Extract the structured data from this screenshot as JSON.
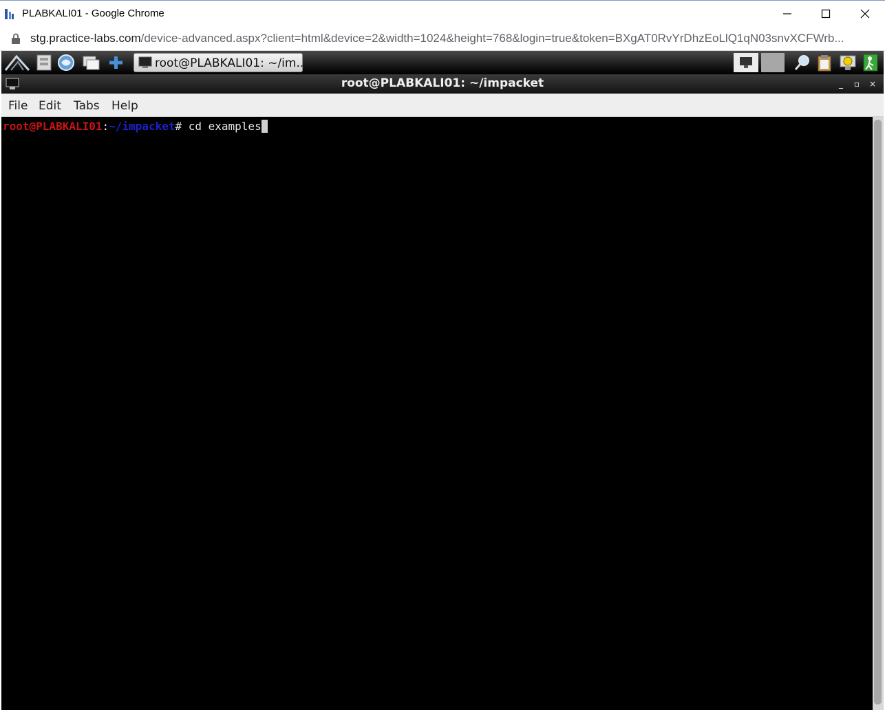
{
  "browser": {
    "window_title": "PLABKALI01 - Google Chrome",
    "url_host": "stg.practice-labs.com",
    "url_path": "/device-advanced.aspx?client=html&device=2&width=1024&height=768&login=true&token=BXgAT0RvYrDhzEoLlQ1qN03snvXCFWrb...",
    "controls": [
      "minimize-icon",
      "maximize-icon",
      "close-icon"
    ]
  },
  "panel": {
    "launchers": [
      "kali-menu-icon",
      "file-manager-icon",
      "web-browser-icon",
      "show-desktop-icon",
      "add-icon"
    ],
    "task_button_label": "root@PLABKALI01: ~/im...",
    "tray": [
      "desktop-1",
      "desktop-2",
      "search-icon",
      "clipboard-icon",
      "notification-icon",
      "logout-icon"
    ]
  },
  "terminal": {
    "window_title": "root@PLABKALI01: ~/impacket",
    "title_controls": [
      "_",
      "▫",
      "×"
    ],
    "menu": [
      "File",
      "Edit",
      "Tabs",
      "Help"
    ],
    "prompt_user": "root@PLABKALI01",
    "prompt_sep": ":",
    "prompt_path": "~/impacket",
    "prompt_symbol": "# ",
    "command": "cd examples"
  },
  "colors": {
    "prompt_user": "#c81414",
    "prompt_path": "#1a22c8",
    "terminal_bg": "#000000"
  }
}
